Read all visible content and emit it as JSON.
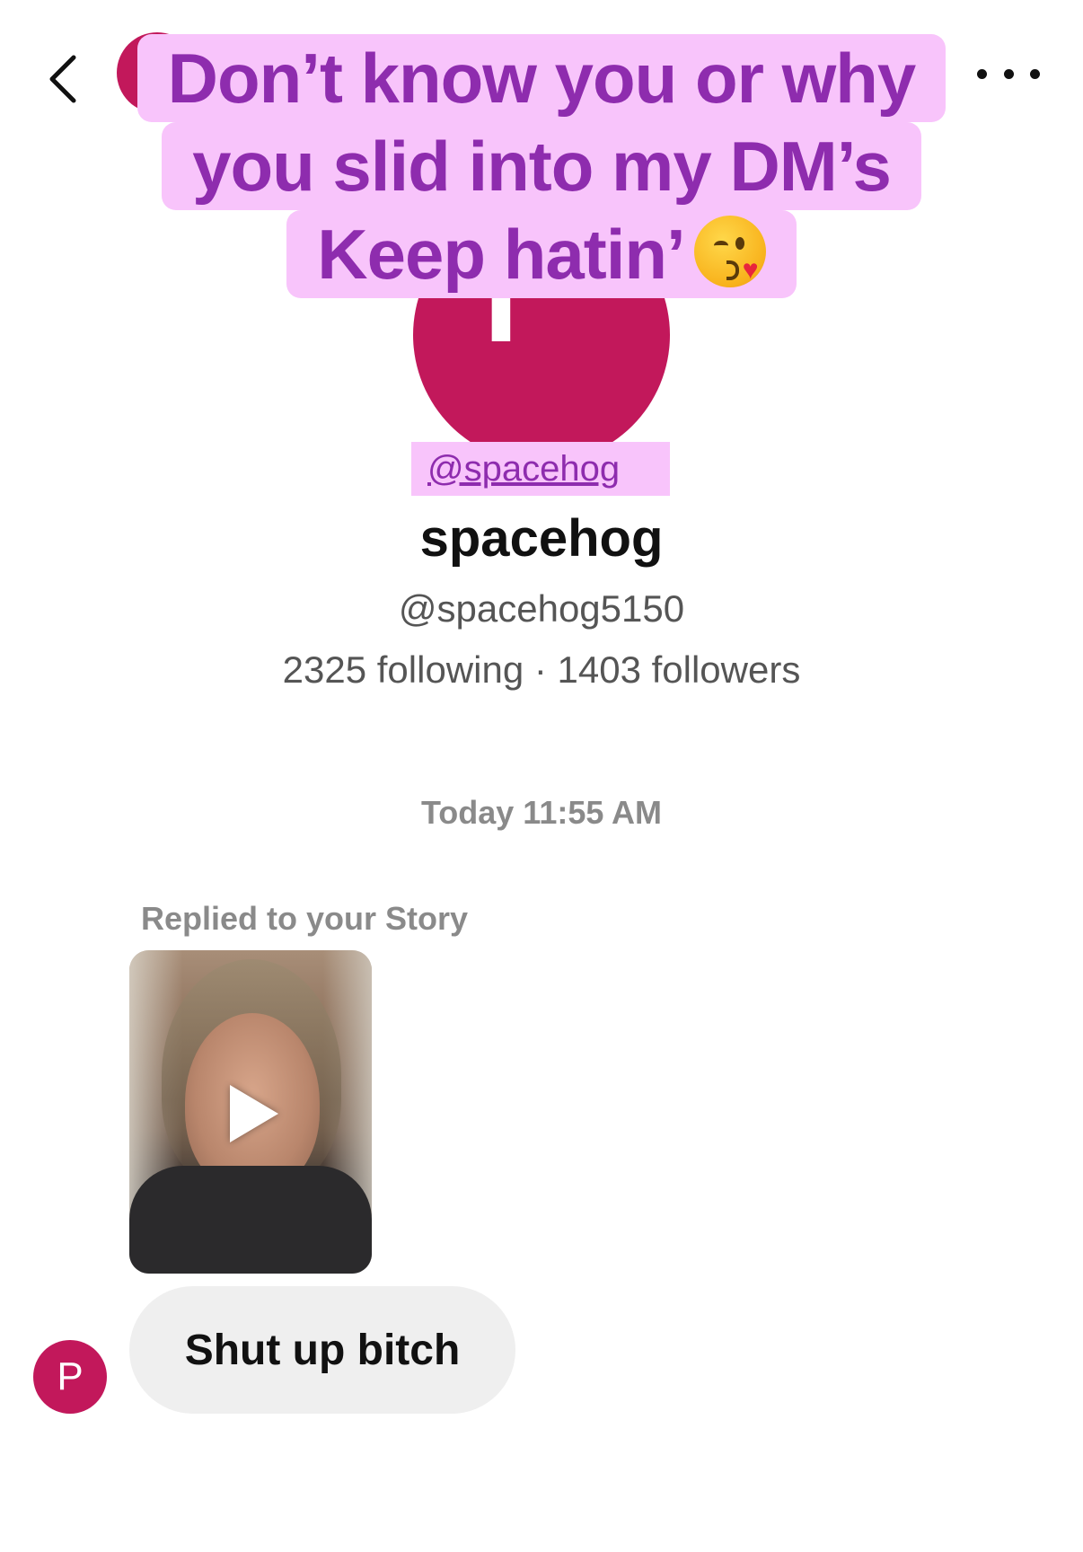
{
  "header": {
    "back_icon": "chevron-left-icon",
    "more_icon": "more-horizontal-icon"
  },
  "sticker": {
    "lines": [
      "Don’t know you or why",
      "you slid into my DM’s",
      "Keep hatin’"
    ],
    "emoji": "face-blowing-kiss-emoji"
  },
  "profile": {
    "avatar_letter": "P",
    "mention": "@spacehog",
    "name": "spacehog",
    "handle": "@spacehog5150",
    "stats": "2325 following · 1403 followers"
  },
  "thread": {
    "timestamp": "Today 11:55 AM",
    "story_reply_label": "Replied to your Story",
    "message": "Shut up bitch",
    "sender_avatar_letter": "P"
  },
  "colors": {
    "avatar": "#c2185b",
    "sticker_bg": "#f8c4fb",
    "sticker_text": "#8e2cae",
    "bubble_bg": "#efefef"
  }
}
